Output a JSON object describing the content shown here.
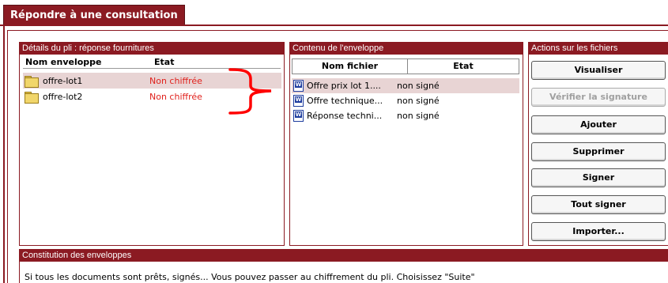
{
  "tab": {
    "title": "Répondre à une consultation"
  },
  "panels": {
    "pli": {
      "header": "Détails du pli : réponse fournitures",
      "columns": [
        "Nom enveloppe",
        "Etat"
      ],
      "rows": [
        {
          "name": "offre-lot1",
          "state": "Non chiffrée",
          "selected": true
        },
        {
          "name": "offre-lot2",
          "state": "Non chiffrée",
          "selected": false
        }
      ]
    },
    "contenu": {
      "header": "Contenu de l'enveloppe",
      "columns": [
        "Nom fichier",
        "Etat"
      ],
      "rows": [
        {
          "name": "Offre prix lot 1....",
          "state": "non signé",
          "selected": true
        },
        {
          "name": "Offre technique...",
          "state": "non signé",
          "selected": false
        },
        {
          "name": "Réponse techni...",
          "state": "non signé",
          "selected": false
        }
      ]
    },
    "actions": {
      "header": "Actions sur les fichiers",
      "buttons": [
        {
          "label": "Visualiser",
          "disabled": false
        },
        {
          "label": "Vérifier la signature",
          "disabled": true
        },
        {
          "label": "Ajouter",
          "disabled": false
        },
        {
          "label": "Supprimer",
          "disabled": false
        },
        {
          "label": "Signer",
          "disabled": false
        },
        {
          "label": "Tout signer",
          "disabled": false
        },
        {
          "label": "Importer...",
          "disabled": false
        }
      ]
    },
    "constitution": {
      "header": "Constitution des enveloppes",
      "message": "Si tous les documents sont prêts, signés... Vous pouvez passer au chiffrement du pli. Choisissez \"Suite\""
    }
  },
  "colors": {
    "accent": "#8b1a22",
    "state_red": "#e0211c",
    "annotation_red": "#ff0000",
    "selected_row": "#e8d4d4"
  },
  "icons": {
    "folder": "folder-icon",
    "document": "word-document-icon"
  }
}
